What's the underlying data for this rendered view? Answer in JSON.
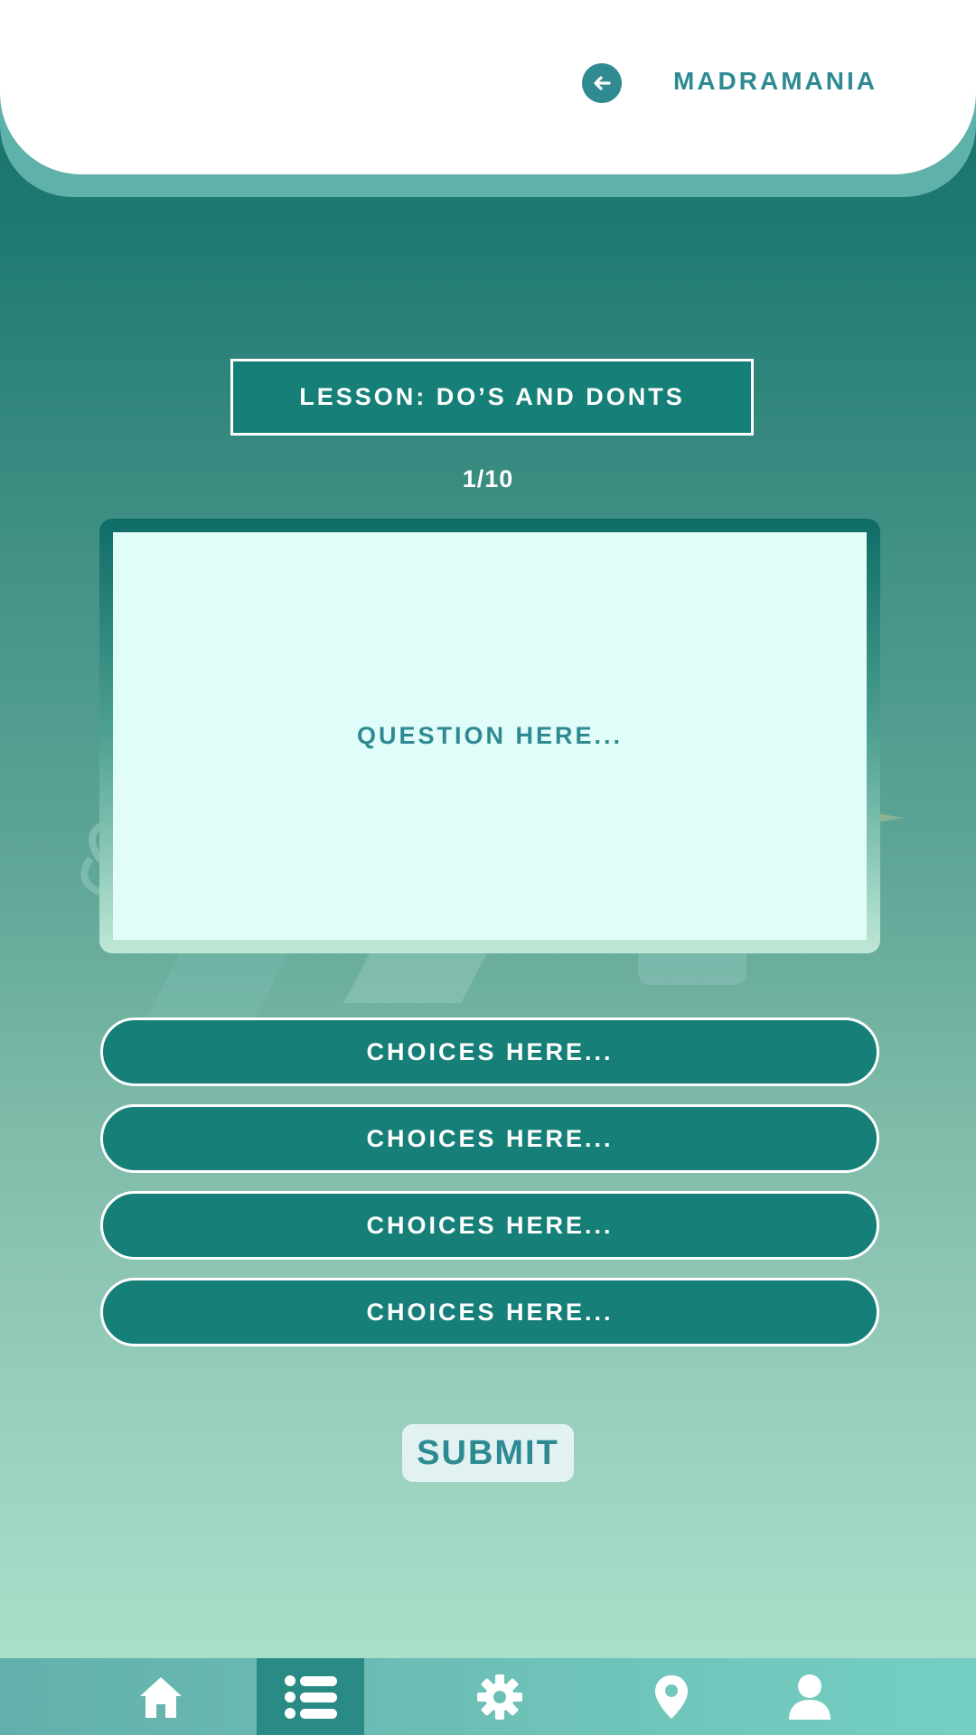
{
  "header": {
    "brand": "MADRAMANIA",
    "back_icon": "arrow-left-icon"
  },
  "lesson": {
    "title": "LESSON: DO’S AND DONTS",
    "progress": "1/10"
  },
  "question": {
    "text": "QUESTION HERE..."
  },
  "choices": [
    {
      "label": "CHOICES HERE..."
    },
    {
      "label": "CHOICES HERE..."
    },
    {
      "label": "CHOICES HERE..."
    },
    {
      "label": "CHOICES HERE..."
    }
  ],
  "actions": {
    "submit_label": "SUBMIT"
  },
  "bottom_nav": {
    "items": [
      {
        "icon": "home-icon",
        "active": false
      },
      {
        "icon": "list-icon",
        "active": true
      },
      {
        "icon": "gear-icon",
        "active": false
      },
      {
        "icon": "location-pin-icon",
        "active": false
      },
      {
        "icon": "user-icon",
        "active": false
      }
    ]
  },
  "colors": {
    "primary": "#167f77",
    "accent_text": "#2e8a92",
    "question_bg": "#e1fdf9",
    "header_bg": "#ffffff"
  }
}
